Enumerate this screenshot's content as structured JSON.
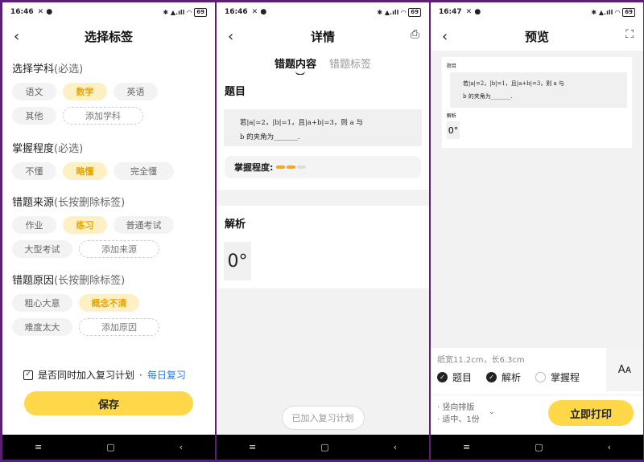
{
  "panel1": {
    "status": {
      "time": "16:46",
      "signal": "✱ ▲.ıll ◠",
      "battery": "69"
    },
    "title": "选择标签",
    "sections": [
      {
        "title": "选择学科",
        "hint": "(必选)",
        "chips": [
          "语文",
          "数学",
          "英语",
          "其他"
        ],
        "add": "添加学科",
        "selected": 1
      },
      {
        "title": "掌握程度",
        "hint": "(必选)",
        "chips": [
          "不懂",
          "略懂",
          "完全懂"
        ],
        "add": "",
        "selected": 1
      },
      {
        "title": "错题来源",
        "hint": "(长按删除标签)",
        "chips": [
          "作业",
          "练习",
          "普通考试",
          "大型考试"
        ],
        "add": "添加来源",
        "selected": 1
      },
      {
        "title": "错题原因",
        "hint": "(长按删除标签)",
        "chips": [
          "粗心大意",
          "概念不清",
          "难度太大"
        ],
        "add": "添加原因",
        "selected": 1
      }
    ],
    "review_label": "是否同时加入复习计划",
    "review_sep": "·",
    "review_link": "每日复习",
    "save_label": "保存"
  },
  "panel2": {
    "status": {
      "time": "16:46",
      "signal": "✱ ▲.ıll ◠",
      "battery": "69"
    },
    "title": "详情",
    "tabs": [
      "错题内容",
      "错题标签"
    ],
    "question_title": "题目",
    "question_text_1": "若|a|=2，|b|=1，且|a+b|=3，则 a 与",
    "question_text_2": "b 的夹角为_______.",
    "mastery_label": "掌握程度:",
    "mastery_level": 2,
    "mastery_max": 3,
    "analysis_title": "解析",
    "answer": "0°",
    "added_label": "已加入复习计划"
  },
  "panel3": {
    "status": {
      "time": "16:47",
      "signal": "✱ ▲.ıll ◠",
      "battery": "69"
    },
    "title": "预览",
    "paper_title": "题目",
    "paper_text_1": "若|a|=2，|b|=1，且|a+b|=3，则 a 与",
    "paper_text_2": "b 的夹角为_______.",
    "paper_answer_title": "解析",
    "paper_answer": "0°",
    "size_text": "纸宽11.2cm，长6.3cm",
    "font_button": "Aᴀ",
    "options": [
      {
        "label": "题目",
        "checked": true
      },
      {
        "label": "解析",
        "checked": true
      },
      {
        "label": "掌握程",
        "checked": false
      }
    ],
    "layout_1": "· 竖向排版",
    "layout_2": "· 适中、1份",
    "print_label": "立即打印"
  },
  "nav": {
    "menu": "≡",
    "home": "▢",
    "back": "‹"
  }
}
